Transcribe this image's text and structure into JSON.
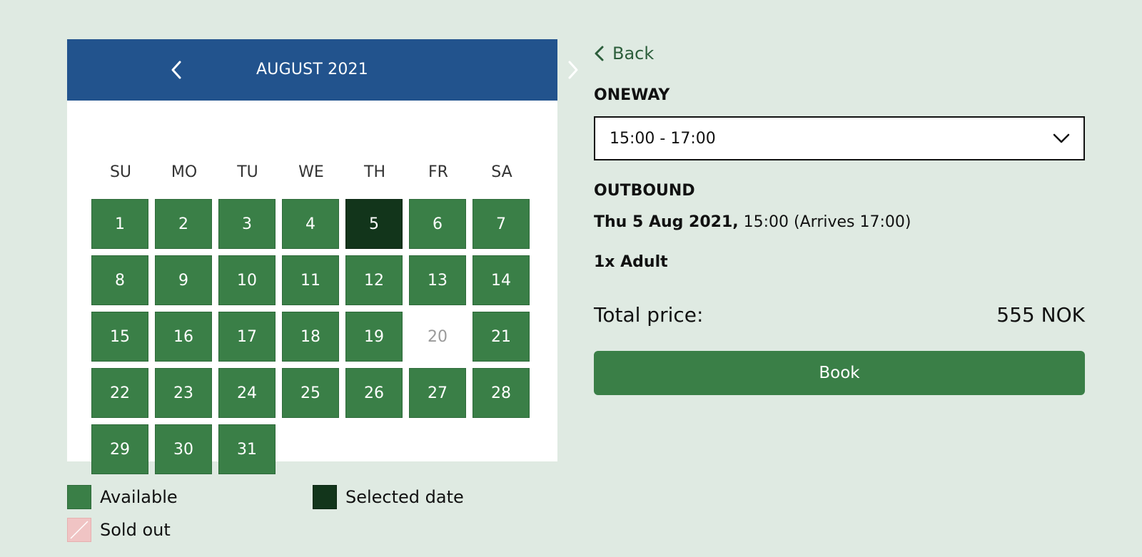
{
  "calendar": {
    "month_label": "AUGUST 2021",
    "weekdays": [
      "SU",
      "MO",
      "TU",
      "WE",
      "TH",
      "FR",
      "SA"
    ],
    "days": [
      {
        "n": "1",
        "status": "available"
      },
      {
        "n": "2",
        "status": "available"
      },
      {
        "n": "3",
        "status": "available"
      },
      {
        "n": "4",
        "status": "available"
      },
      {
        "n": "5",
        "status": "selected"
      },
      {
        "n": "6",
        "status": "available"
      },
      {
        "n": "7",
        "status": "available"
      },
      {
        "n": "8",
        "status": "available"
      },
      {
        "n": "9",
        "status": "available"
      },
      {
        "n": "10",
        "status": "available"
      },
      {
        "n": "11",
        "status": "available"
      },
      {
        "n": "12",
        "status": "available"
      },
      {
        "n": "13",
        "status": "available"
      },
      {
        "n": "14",
        "status": "available"
      },
      {
        "n": "15",
        "status": "available"
      },
      {
        "n": "16",
        "status": "available"
      },
      {
        "n": "17",
        "status": "available"
      },
      {
        "n": "18",
        "status": "available"
      },
      {
        "n": "19",
        "status": "available"
      },
      {
        "n": "20",
        "status": "soldout"
      },
      {
        "n": "21",
        "status": "available"
      },
      {
        "n": "22",
        "status": "available"
      },
      {
        "n": "23",
        "status": "available"
      },
      {
        "n": "24",
        "status": "available"
      },
      {
        "n": "25",
        "status": "available"
      },
      {
        "n": "26",
        "status": "available"
      },
      {
        "n": "27",
        "status": "available"
      },
      {
        "n": "28",
        "status": "available"
      },
      {
        "n": "29",
        "status": "available"
      },
      {
        "n": "30",
        "status": "available"
      },
      {
        "n": "31",
        "status": "available"
      }
    ],
    "first_weekday_index": 0,
    "prev_icon": "chevron-left-icon",
    "next_icon": "chevron-right-icon"
  },
  "legend": {
    "available": "Available",
    "selected": "Selected date",
    "soldout": "Sold out"
  },
  "panel": {
    "back_label": "Back",
    "trip_type_label": "ONEWAY",
    "time_select_value": "15:00 - 17:00",
    "outbound_label": "OUTBOUND",
    "outbound_date": "Thu 5 Aug 2021,",
    "outbound_time": " 15:00 (Arrives 17:00)",
    "passengers": "1x Adult",
    "total_label": "Total price:",
    "total_value": "555 NOK",
    "book_label": "Book"
  },
  "colors": {
    "background": "#dfeae2",
    "header_blue": "#22538d",
    "available_green": "#3a7f47",
    "selected_dark": "#12351b",
    "soldout_pink": "#f0c4c4",
    "back_link": "#2c5e3b"
  }
}
